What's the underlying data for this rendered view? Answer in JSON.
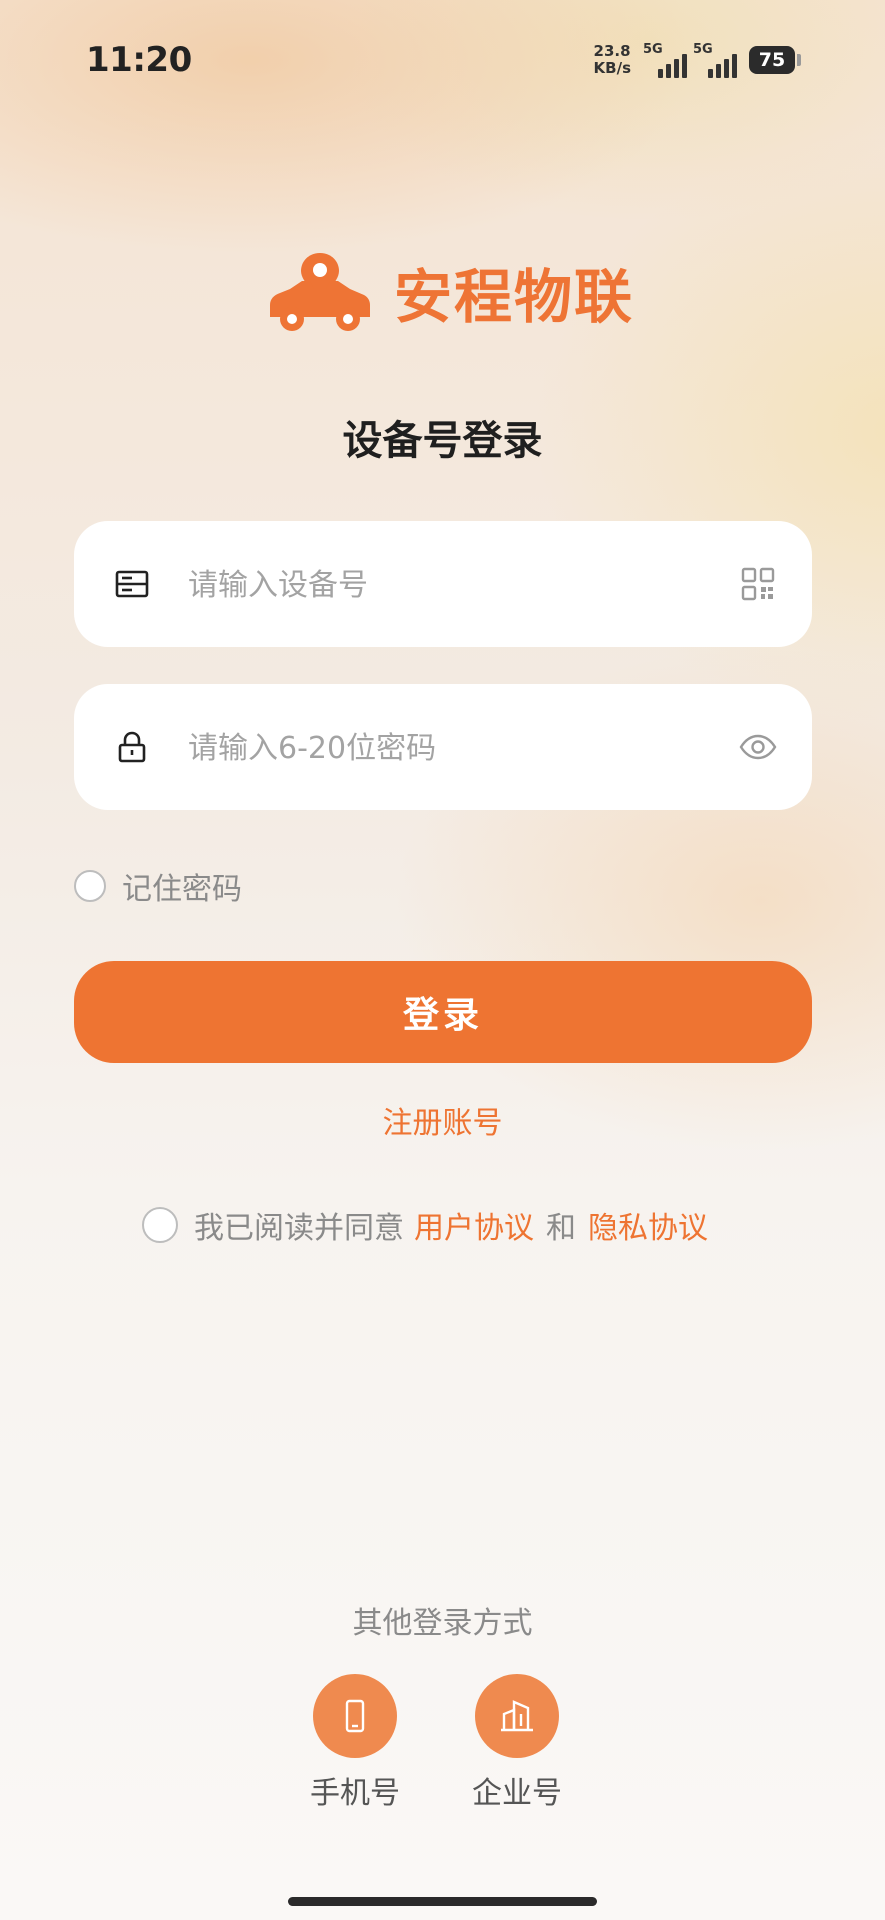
{
  "status_bar": {
    "time": "11:20",
    "net_speed_value": "23.8",
    "net_speed_unit": "KB/s",
    "signal_1_label": "5G",
    "signal_2_label": "5G",
    "battery": "75"
  },
  "brand": {
    "name": "安程物联",
    "accent_color": "#EE7432",
    "logo_icon": "car-location-pin-icon"
  },
  "page_title": "设备号登录",
  "form": {
    "device_field": {
      "placeholder": "请输入设备号",
      "value": "",
      "lead_icon": "device-card-icon",
      "trail_icon": "qr-scan-icon"
    },
    "password_field": {
      "placeholder": "请输入6-20位密码",
      "value": "",
      "lead_icon": "lock-icon",
      "trail_icon": "eye-icon"
    },
    "remember_label": "记住密码",
    "remember_checked": false,
    "login_label": "登录"
  },
  "register_label": "注册账号",
  "agreement": {
    "checked": false,
    "prefix": "我已阅读并同意",
    "user_agreement": "用户协议",
    "conjunction": "和",
    "privacy_agreement": "隐私协议"
  },
  "other_login": {
    "title": "其他登录方式",
    "options": [
      {
        "label": "手机号",
        "icon": "phone-icon"
      },
      {
        "label": "企业号",
        "icon": "building-icon"
      }
    ]
  }
}
